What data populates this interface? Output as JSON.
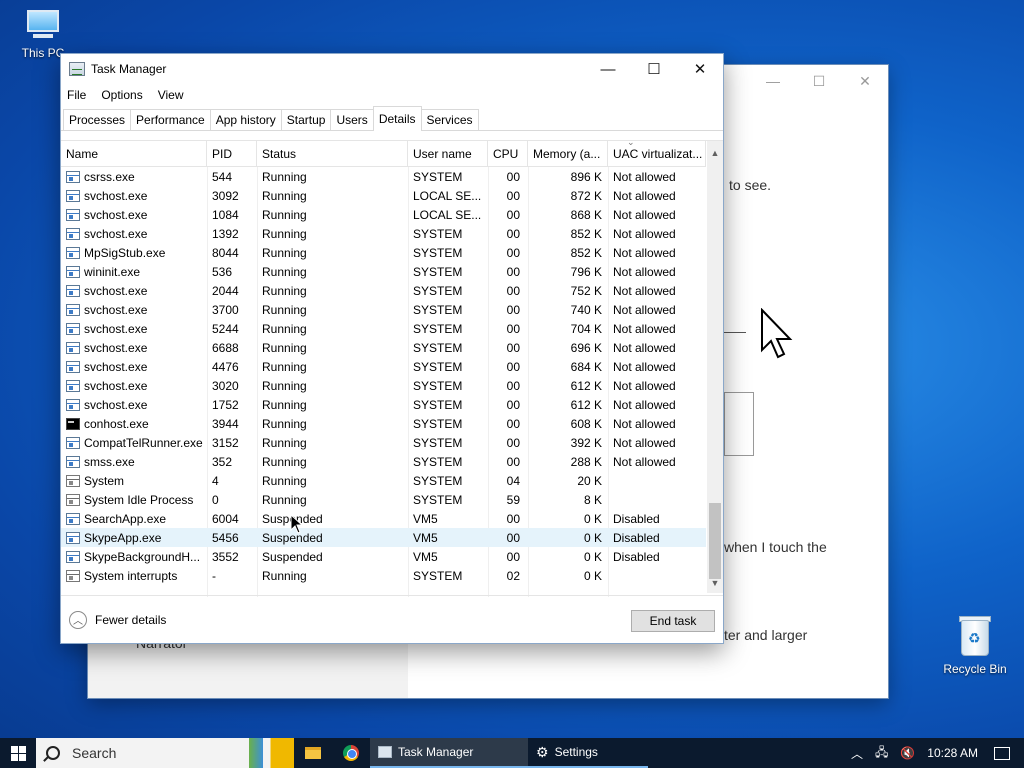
{
  "desktop": {
    "this_pc_label": "This PC",
    "recycle_bin_label": "Recycle Bin"
  },
  "settings_window": {
    "text_to_see": "to see.",
    "text_touch": "when I touch the",
    "text_larger": "ter and larger",
    "narrator_label": "Narrator"
  },
  "task_manager": {
    "title": "Task Manager",
    "menu": [
      "File",
      "Options",
      "View"
    ],
    "tabs": [
      "Processes",
      "Performance",
      "App history",
      "Startup",
      "Users",
      "Details",
      "Services"
    ],
    "active_tab": "Details",
    "columns": {
      "name": "Name",
      "pid": "PID",
      "status": "Status",
      "user": "User name",
      "cpu": "CPU",
      "memory": "Memory (a...",
      "uac": "UAC virtualizat..."
    },
    "rows": [
      {
        "name": "csrss.exe",
        "pid": "544",
        "status": "Running",
        "user": "SYSTEM",
        "cpu": "00",
        "memory": "896 K",
        "uac": "Not allowed",
        "icon": "process-icon"
      },
      {
        "name": "svchost.exe",
        "pid": "3092",
        "status": "Running",
        "user": "LOCAL SE...",
        "cpu": "00",
        "memory": "872 K",
        "uac": "Not allowed",
        "icon": "process-icon"
      },
      {
        "name": "svchost.exe",
        "pid": "1084",
        "status": "Running",
        "user": "LOCAL SE...",
        "cpu": "00",
        "memory": "868 K",
        "uac": "Not allowed",
        "icon": "process-icon"
      },
      {
        "name": "svchost.exe",
        "pid": "1392",
        "status": "Running",
        "user": "SYSTEM",
        "cpu": "00",
        "memory": "852 K",
        "uac": "Not allowed",
        "icon": "process-icon"
      },
      {
        "name": "MpSigStub.exe",
        "pid": "8044",
        "status": "Running",
        "user": "SYSTEM",
        "cpu": "00",
        "memory": "852 K",
        "uac": "Not allowed",
        "icon": "process-icon"
      },
      {
        "name": "wininit.exe",
        "pid": "536",
        "status": "Running",
        "user": "SYSTEM",
        "cpu": "00",
        "memory": "796 K",
        "uac": "Not allowed",
        "icon": "process-icon"
      },
      {
        "name": "svchost.exe",
        "pid": "2044",
        "status": "Running",
        "user": "SYSTEM",
        "cpu": "00",
        "memory": "752 K",
        "uac": "Not allowed",
        "icon": "process-icon"
      },
      {
        "name": "svchost.exe",
        "pid": "3700",
        "status": "Running",
        "user": "SYSTEM",
        "cpu": "00",
        "memory": "740 K",
        "uac": "Not allowed",
        "icon": "process-icon"
      },
      {
        "name": "svchost.exe",
        "pid": "5244",
        "status": "Running",
        "user": "SYSTEM",
        "cpu": "00",
        "memory": "704 K",
        "uac": "Not allowed",
        "icon": "process-icon"
      },
      {
        "name": "svchost.exe",
        "pid": "6688",
        "status": "Running",
        "user": "SYSTEM",
        "cpu": "00",
        "memory": "696 K",
        "uac": "Not allowed",
        "icon": "process-icon"
      },
      {
        "name": "svchost.exe",
        "pid": "4476",
        "status": "Running",
        "user": "SYSTEM",
        "cpu": "00",
        "memory": "684 K",
        "uac": "Not allowed",
        "icon": "process-icon"
      },
      {
        "name": "svchost.exe",
        "pid": "3020",
        "status": "Running",
        "user": "SYSTEM",
        "cpu": "00",
        "memory": "612 K",
        "uac": "Not allowed",
        "icon": "process-icon"
      },
      {
        "name": "svchost.exe",
        "pid": "1752",
        "status": "Running",
        "user": "SYSTEM",
        "cpu": "00",
        "memory": "612 K",
        "uac": "Not allowed",
        "icon": "process-icon"
      },
      {
        "name": "conhost.exe",
        "pid": "3944",
        "status": "Running",
        "user": "SYSTEM",
        "cpu": "00",
        "memory": "608 K",
        "uac": "Not allowed",
        "icon": "console-icon"
      },
      {
        "name": "CompatTelRunner.exe",
        "pid": "3152",
        "status": "Running",
        "user": "SYSTEM",
        "cpu": "00",
        "memory": "392 K",
        "uac": "Not allowed",
        "icon": "process-icon"
      },
      {
        "name": "smss.exe",
        "pid": "352",
        "status": "Running",
        "user": "SYSTEM",
        "cpu": "00",
        "memory": "288 K",
        "uac": "Not allowed",
        "icon": "process-icon"
      },
      {
        "name": "System",
        "pid": "4",
        "status": "Running",
        "user": "SYSTEM",
        "cpu": "04",
        "memory": "20 K",
        "uac": "",
        "icon": "system-icon"
      },
      {
        "name": "System Idle Process",
        "pid": "0",
        "status": "Running",
        "user": "SYSTEM",
        "cpu": "59",
        "memory": "8 K",
        "uac": "",
        "icon": "system-icon"
      },
      {
        "name": "SearchApp.exe",
        "pid": "6004",
        "status": "Suspended",
        "user": "VM5",
        "cpu": "00",
        "memory": "0 K",
        "uac": "Disabled",
        "icon": "process-icon"
      },
      {
        "name": "SkypeApp.exe",
        "pid": "5456",
        "status": "Suspended",
        "user": "VM5",
        "cpu": "00",
        "memory": "0 K",
        "uac": "Disabled",
        "icon": "process-icon",
        "selected": true
      },
      {
        "name": "SkypeBackgroundH...",
        "pid": "3552",
        "status": "Suspended",
        "user": "VM5",
        "cpu": "00",
        "memory": "0 K",
        "uac": "Disabled",
        "icon": "process-icon"
      },
      {
        "name": "System interrupts",
        "pid": "-",
        "status": "Running",
        "user": "SYSTEM",
        "cpu": "02",
        "memory": "0 K",
        "uac": "",
        "icon": "system-icon"
      }
    ],
    "fewer_details": "Fewer details",
    "end_task": "End task"
  },
  "taskbar": {
    "search_placeholder": "Search",
    "apps": [
      {
        "label": "Task Manager",
        "active": true
      },
      {
        "label": "Settings",
        "active": false
      }
    ],
    "clock": "10:28 AM"
  }
}
